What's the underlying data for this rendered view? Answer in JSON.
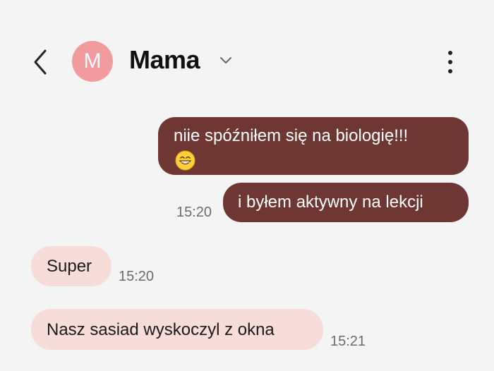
{
  "header": {
    "back_icon": "chevron-left-icon",
    "avatar_letter": "M",
    "contact_name": "Mama",
    "dropdown_icon": "chevron-down-icon",
    "menu_icon": "more-vertical-icon"
  },
  "colors": {
    "outgoing_bubble": "#6e3733",
    "incoming_bubble": "#f7ddd9",
    "avatar": "#f29b9f",
    "background": "#f4f4f4"
  },
  "messages": [
    {
      "direction": "outgoing",
      "text": "niie spóźniłem się na biologię!!!",
      "emoji": "😁",
      "time": ""
    },
    {
      "direction": "outgoing",
      "text": "i byłem aktywny na lekcji",
      "time": "15:20"
    },
    {
      "direction": "incoming",
      "text": "Super",
      "time": "15:20"
    },
    {
      "direction": "incoming",
      "text": "Nasz sasiad wyskoczyl z okna",
      "time": "15:21"
    }
  ]
}
